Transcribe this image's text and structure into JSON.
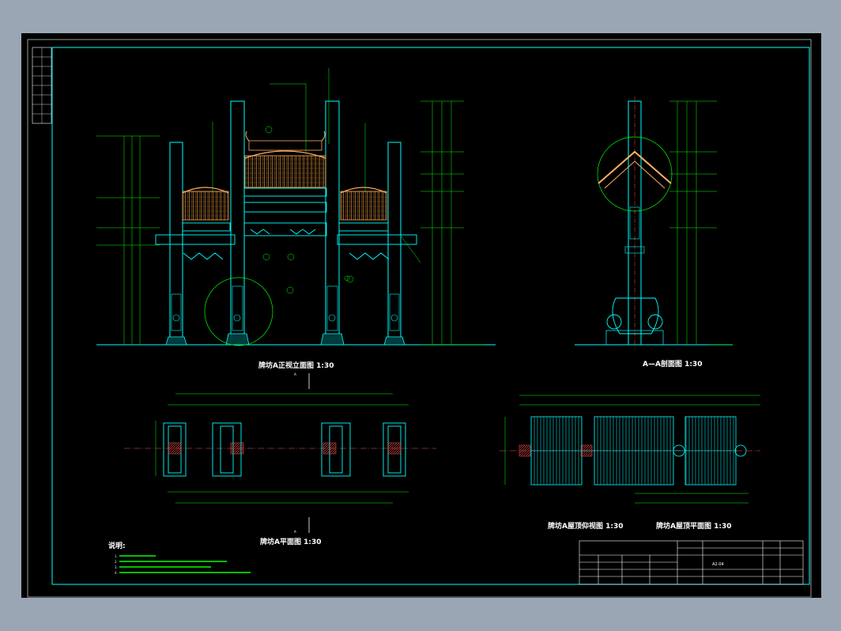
{
  "drawing": {
    "sheet_no": "A2-04",
    "colors": {
      "frame": "#00ffff",
      "dimension": "#00ff00",
      "structure": "#00ffff",
      "roof": "#ffb060",
      "callout": "#00ff00",
      "hatch": "#ff6060",
      "text": "#ffffff"
    }
  },
  "views": {
    "front_elevation": {
      "title": "牌坊A正视立面图 1:30"
    },
    "section_aa": {
      "title": "A—A剖面图 1:30"
    },
    "plan": {
      "title": "牌坊A平面图 1:30",
      "section_mark": "A"
    },
    "roof_bottom": {
      "title": "牌坊A屋顶仰视图 1:30"
    },
    "roof_plan": {
      "title": "牌坊A屋顶平面图 1:30"
    }
  },
  "notes": {
    "heading": "说明:",
    "items": [
      "1.",
      "2.",
      "3.",
      "4."
    ]
  },
  "title_block": {
    "sheet_no": "A2-04"
  }
}
